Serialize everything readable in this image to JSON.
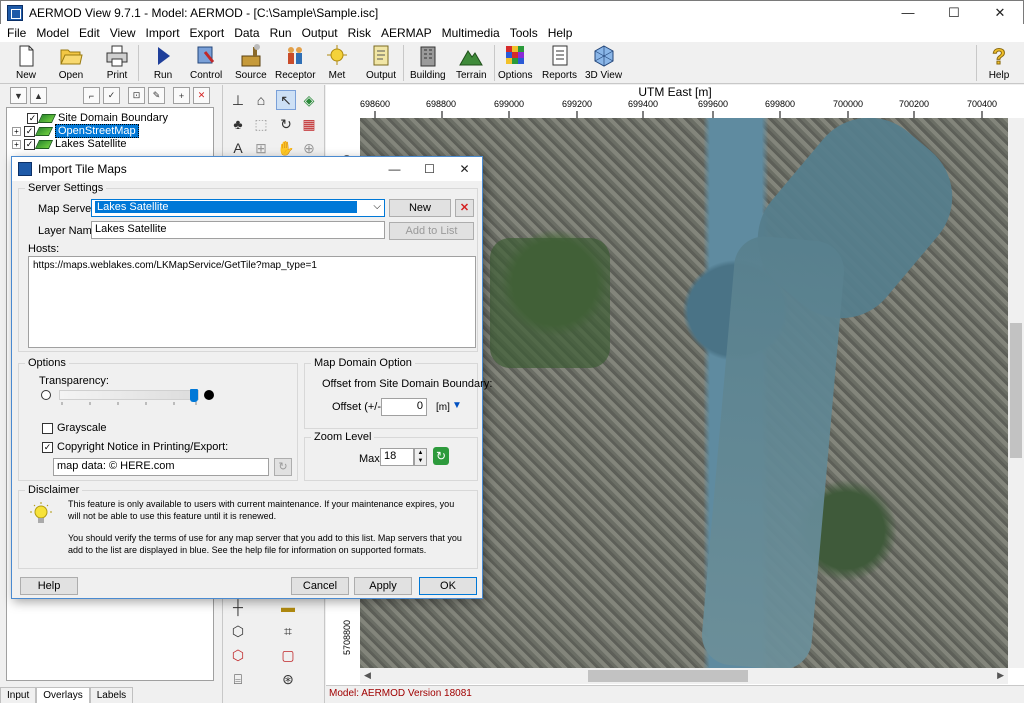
{
  "window": {
    "title": "AERMOD View 9.7.1 - Model: AERMOD - [C:\\Sample\\Sample.isc]",
    "controls": {
      "minimize": "—",
      "maximize": "☐",
      "close": "✕"
    }
  },
  "menu": [
    "File",
    "Model",
    "Edit",
    "View",
    "Import",
    "Export",
    "Data",
    "Run",
    "Output",
    "Risk",
    "AERMAP",
    "Multimedia",
    "Tools",
    "Help"
  ],
  "toolbar": {
    "new": "New",
    "open": "Open",
    "print": "Print",
    "run": "Run",
    "control": "Control",
    "source": "Source",
    "receptor": "Receptor",
    "met": "Met",
    "output": "Output",
    "building": "Building",
    "terrain": "Terrain",
    "options": "Options",
    "reports": "Reports",
    "view3d": "3D View",
    "help": "Help"
  },
  "layers": {
    "items": [
      {
        "label": "Site Domain Boundary",
        "checked": true,
        "expandable": false
      },
      {
        "label": "OpenStreetMap",
        "checked": true,
        "expandable": true,
        "selected": true
      },
      {
        "label": "Lakes Satellite",
        "checked": true,
        "expandable": true
      }
    ],
    "tabs": [
      "Input",
      "Overlays",
      "Labels"
    ],
    "active_tab": "Overlays"
  },
  "map": {
    "x_axis_title": "UTM East [m]",
    "x_ticks": [
      "698600",
      "698800",
      "699000",
      "699200",
      "699400",
      "699600",
      "699800",
      "700000",
      "700200",
      "700400"
    ],
    "y_ticks_visible": [
      "5708800"
    ],
    "y_top_tick_fragment": "00"
  },
  "status": {
    "text": "Model: AERMOD Version 18081"
  },
  "dialog": {
    "title": "Import Tile Maps",
    "server_settings": {
      "group_title": "Server Settings",
      "map_server_label": "Map Server:",
      "map_server_value": "Lakes Satellite",
      "new_button": "New",
      "layer_name_label": "Layer Name:",
      "layer_name_value": "Lakes Satellite",
      "add_to_list_button": "Add to List",
      "hosts_label": "Hosts:",
      "hosts_value": "https://maps.weblakes.com/LKMapService/GetTile?map_type=1"
    },
    "options": {
      "group_title": "Options",
      "transparency_label": "Transparency:",
      "transparency_level": 1.0,
      "grayscale_label": "Grayscale",
      "grayscale_checked": false,
      "copyright_label": "Copyright Notice in Printing/Export:",
      "copyright_checked": true,
      "copyright_value": "map data: © HERE.com"
    },
    "map_domain": {
      "group_title": "Map Domain Option",
      "offset_heading": "Offset from Site Domain Boundary:",
      "offset_label": "Offset (+/-):",
      "offset_value": "0",
      "offset_unit": "[m]"
    },
    "zoom": {
      "group_title": "Zoom Level",
      "max_label": "Max:",
      "max_value": "18"
    },
    "disclaimer": {
      "group_title": "Disclaimer",
      "text1": "This feature is only available to users with current maintenance. If your maintenance expires, you will not be able to use this feature until it is renewed.",
      "text2": "You should verify the terms of use for any map server that you add to this list. Map servers that you add to the list are displayed in blue. See the help file for information on supported formats."
    },
    "buttons": {
      "help": "Help",
      "cancel": "Cancel",
      "apply": "Apply",
      "ok": "OK"
    }
  },
  "colors": {
    "accent": "#0078d7",
    "status_text": "#a00000",
    "dialog_border": "#4a8ad0"
  }
}
